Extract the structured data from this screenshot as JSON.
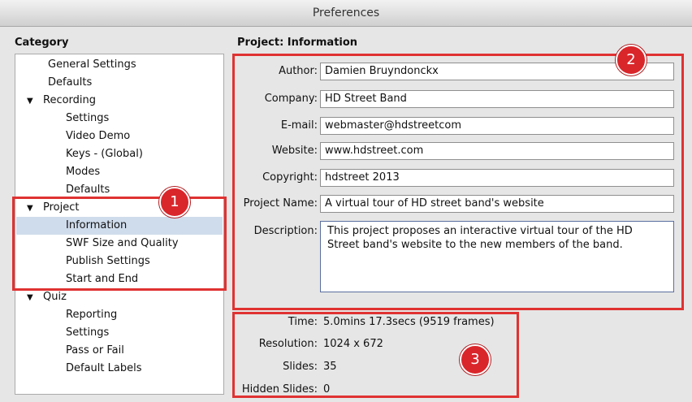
{
  "window": {
    "title": "Preferences"
  },
  "category": {
    "title": "Category",
    "items": [
      {
        "label": "General Settings"
      },
      {
        "label": "Defaults"
      },
      {
        "label": "Recording"
      },
      {
        "label": "Settings"
      },
      {
        "label": "Video Demo"
      },
      {
        "label": "Keys - (Global)"
      },
      {
        "label": "Modes"
      },
      {
        "label": "Defaults"
      },
      {
        "label": "Project"
      },
      {
        "label": "Information"
      },
      {
        "label": "SWF Size and Quality"
      },
      {
        "label": "Publish Settings"
      },
      {
        "label": "Start and End"
      },
      {
        "label": "Quiz"
      },
      {
        "label": "Reporting"
      },
      {
        "label": "Settings"
      },
      {
        "label": "Pass or Fail"
      },
      {
        "label": "Default Labels"
      }
    ]
  },
  "project_info": {
    "title": "Project: Information",
    "author_label": "Author:",
    "author": "Damien Bruyndonckx",
    "company_label": "Company:",
    "company": "HD Street Band",
    "email_label": "E-mail:",
    "email": "webmaster@hdstreetcom",
    "website_label": "Website:",
    "website": "www.hdstreet.com",
    "copyright_label": "Copyright:",
    "copyright": "hdstreet 2013",
    "project_name_label": "Project Name:",
    "project_name": "A virtual tour of HD street band's website",
    "description_label": "Description:",
    "description": "This project proposes an interactive virtual tour of the HD Street band's website to the new members of the band."
  },
  "stats": {
    "time_label": "Time:",
    "time": "5.0mins 17.3secs (9519 frames)",
    "resolution_label": "Resolution:",
    "resolution": "1024 x 672",
    "slides_label": "Slides:",
    "slides": "35",
    "hidden_label": "Hidden Slides:",
    "hidden": "0"
  },
  "callouts": [
    "1",
    "2",
    "3"
  ],
  "colors": {
    "callout": "#d9262b",
    "selection": "#cfdcec"
  }
}
